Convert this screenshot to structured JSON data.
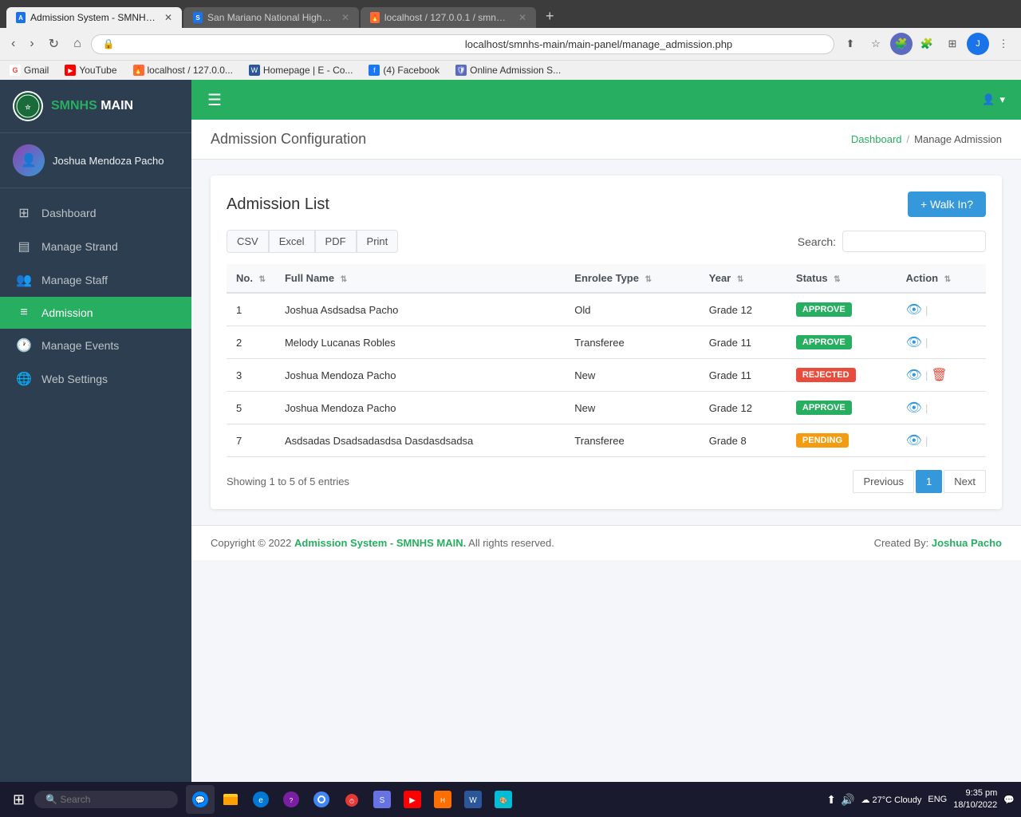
{
  "browser": {
    "tabs": [
      {
        "id": "tab1",
        "label": "Admission System - SMNHS MA...",
        "favicon": "school",
        "active": true
      },
      {
        "id": "tab2",
        "label": "San Mariano National High Scho...",
        "favicon": "school",
        "active": false
      },
      {
        "id": "tab3",
        "label": "localhost / 127.0.0.1 / smnhs_ma...",
        "favicon": "flame",
        "active": false
      }
    ],
    "url": "localhost/smnhs-main/main-panel/manage_admission.php",
    "bookmarks": [
      {
        "label": "Gmail",
        "type": "gmail"
      },
      {
        "label": "YouTube",
        "type": "yt"
      },
      {
        "label": "localhost / 127.0.0...",
        "type": "flame"
      },
      {
        "label": "Homepage | E - Co...",
        "type": "msword"
      },
      {
        "label": "(4) Facebook",
        "type": "fb"
      },
      {
        "label": "Online Admission S...",
        "type": "shield"
      }
    ]
  },
  "sidebar": {
    "logo_text": "SMNHS MAIN",
    "logo_highlight": "SMNHS",
    "username": "Joshua Mendoza Pacho",
    "nav_items": [
      {
        "id": "dashboard",
        "label": "Dashboard",
        "icon": "⊞",
        "active": false
      },
      {
        "id": "manage-strand",
        "label": "Manage Strand",
        "icon": "▤",
        "active": false
      },
      {
        "id": "manage-staff",
        "label": "Manage Staff",
        "icon": "👥",
        "active": false
      },
      {
        "id": "admission",
        "label": "Admission",
        "icon": "≡",
        "active": true
      },
      {
        "id": "manage-events",
        "label": "Manage Events",
        "icon": "🕐",
        "active": false
      },
      {
        "id": "web-settings",
        "label": "Web Settings",
        "icon": "🌐",
        "active": false
      }
    ]
  },
  "topbar": {
    "user_icon": "👤"
  },
  "page": {
    "config_title": "Admission Configuration",
    "breadcrumb_home": "Dashboard",
    "breadcrumb_current": "Manage Admission",
    "card_title": "Admission List",
    "walk_in_btn": "+ Walk In?",
    "export_btns": [
      "CSV",
      "Excel",
      "PDF",
      "Print"
    ],
    "search_label": "Search:",
    "search_placeholder": "",
    "table_headers": [
      "No.",
      "Full Name",
      "Enrolee Type",
      "Year",
      "Status",
      "Action"
    ],
    "table_rows": [
      {
        "no": "1",
        "full_name": "Joshua Asdsadsa Pacho",
        "enrolee_type": "Old",
        "year": "Grade 12",
        "status": "APPROVE",
        "status_type": "approve"
      },
      {
        "no": "2",
        "full_name": "Melody Lucanas Robles",
        "enrolee_type": "Transferee",
        "year": "Grade 11",
        "status": "APPROVE",
        "status_type": "approve"
      },
      {
        "no": "3",
        "full_name": "Joshua Mendoza Pacho",
        "enrolee_type": "New",
        "year": "Grade 11",
        "status": "REJECTED",
        "status_type": "rejected"
      },
      {
        "no": "5",
        "full_name": "Joshua Mendoza Pacho",
        "enrolee_type": "New",
        "year": "Grade 12",
        "status": "APPROVE",
        "status_type": "approve"
      },
      {
        "no": "7",
        "full_name": "Asdsadas Dsadsadasdsa Dasdasdsadsa",
        "enrolee_type": "Transferee",
        "year": "Grade 8",
        "status": "PENDING",
        "status_type": "pending"
      }
    ],
    "showing_text": "Showing 1 to 5 of 5 entries",
    "pagination": {
      "prev": "Previous",
      "pages": [
        "1"
      ],
      "next": "Next",
      "active_page": "1"
    },
    "footer_copy": "Copyright © 2022",
    "footer_app": "Admission System - SMNHS MAIN.",
    "footer_rights": " All rights reserved.",
    "footer_credit": "Created By:",
    "footer_author": "Joshua Pacho"
  },
  "taskbar": {
    "time": "9:35 pm",
    "date": "18/10/2022",
    "weather": "27°C  Cloudy",
    "lang": "ENG"
  }
}
